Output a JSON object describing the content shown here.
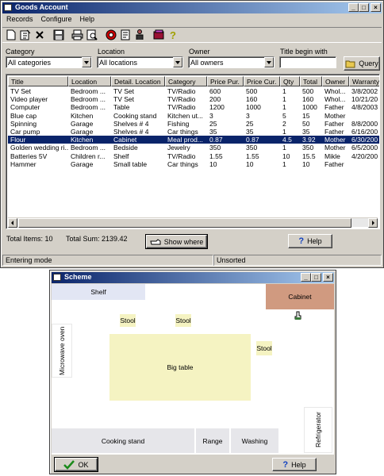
{
  "main_window": {
    "title": "Goods Account",
    "menu": [
      "Records",
      "Configure",
      "Help"
    ],
    "title_buttons": [
      "_",
      "□",
      "×"
    ],
    "filters": {
      "category": {
        "label": "Category",
        "value": "All categories"
      },
      "location": {
        "label": "Location",
        "value": "All locations"
      },
      "owner": {
        "label": "Owner",
        "value": "All owners"
      },
      "title_begin": {
        "label": "Title begin with",
        "value": ""
      }
    },
    "query_button": "Query",
    "columns": [
      "Title",
      "Location",
      "Detail. Location",
      "Category",
      "Price Pur.",
      "Price Cur.",
      "Qty",
      "Total",
      "Owner",
      "Warranty"
    ],
    "rows": [
      [
        "TV Set",
        "Bedroom ...",
        "TV Set",
        "TV/Radio",
        "600",
        "500",
        "1",
        "500",
        "Whol...",
        "3/8/2002"
      ],
      [
        "Video player",
        "Bedroom ...",
        "TV Set",
        "TV/Radio",
        "200",
        "160",
        "1",
        "160",
        "Whol...",
        "10/21/20"
      ],
      [
        "Computer",
        "Bedroom ...",
        "Table",
        "TV/Radio",
        "1200",
        "1000",
        "1",
        "1000",
        "Father",
        "4/8/2003"
      ],
      [
        "Blue cap",
        "Kitchen",
        "Cooking stand",
        "Kitchen ut...",
        "3",
        "3",
        "5",
        "15",
        "Mother",
        ""
      ],
      [
        "Spinning",
        "Garage",
        "Shelves # 4",
        "Fishing",
        "25",
        "25",
        "2",
        "50",
        "Father",
        "8/8/2000"
      ],
      [
        "Car pump",
        "Garage",
        "Shelves # 4",
        "Car things",
        "35",
        "35",
        "1",
        "35",
        "Father",
        "6/16/200"
      ],
      [
        "Flour",
        "Kitchen",
        "Cabinet",
        "Meal prod...",
        "0.87",
        "0.87",
        "4.5",
        "3.92",
        "Mother",
        "6/30/200"
      ],
      [
        "Golden wedding ri...",
        "Bedroom ...",
        "Bedside",
        "Jewelry",
        "350",
        "350",
        "1",
        "350",
        "Mother",
        "6/5/2000"
      ],
      [
        "Batteries 5V",
        "Children r...",
        "Shelf",
        "TV/Radio",
        "1.55",
        "1.55",
        "10",
        "15.5",
        "Mikle",
        "4/20/200"
      ],
      [
        "Hammer",
        "Garage",
        "Small table",
        "Car things",
        "10",
        "10",
        "1",
        "10",
        "Father",
        ""
      ]
    ],
    "selected_row": 6,
    "total_items": "Total Items: 10",
    "total_sum": "Total Sum: 2139.42",
    "show_where_button": "Show where",
    "help_button": "Help",
    "status_mode": "Entering mode",
    "status_sort": "Unsorted"
  },
  "scheme_window": {
    "title": "Scheme",
    "zones": {
      "shelf": "Shelf",
      "cabinet": "Cabinet",
      "microwave": "Microwave oven",
      "stool1": "Stool",
      "stool2": "Stool",
      "stool3": "Stool",
      "big_table": "Big table",
      "cooking_stand": "Cooking stand",
      "range": "Range",
      "washing": "Washing",
      "refrigerator": "Refrigerator"
    },
    "ok_button": "OK",
    "help_button": "Help"
  },
  "colors": {
    "title_active": "#0a246a",
    "face": "#d4d0c8",
    "selection": "#0a246a",
    "cabinet": "#d09a80",
    "table": "#f5f3c2",
    "stand": "#e6e6ea",
    "shelf": "#e2e6f4"
  }
}
